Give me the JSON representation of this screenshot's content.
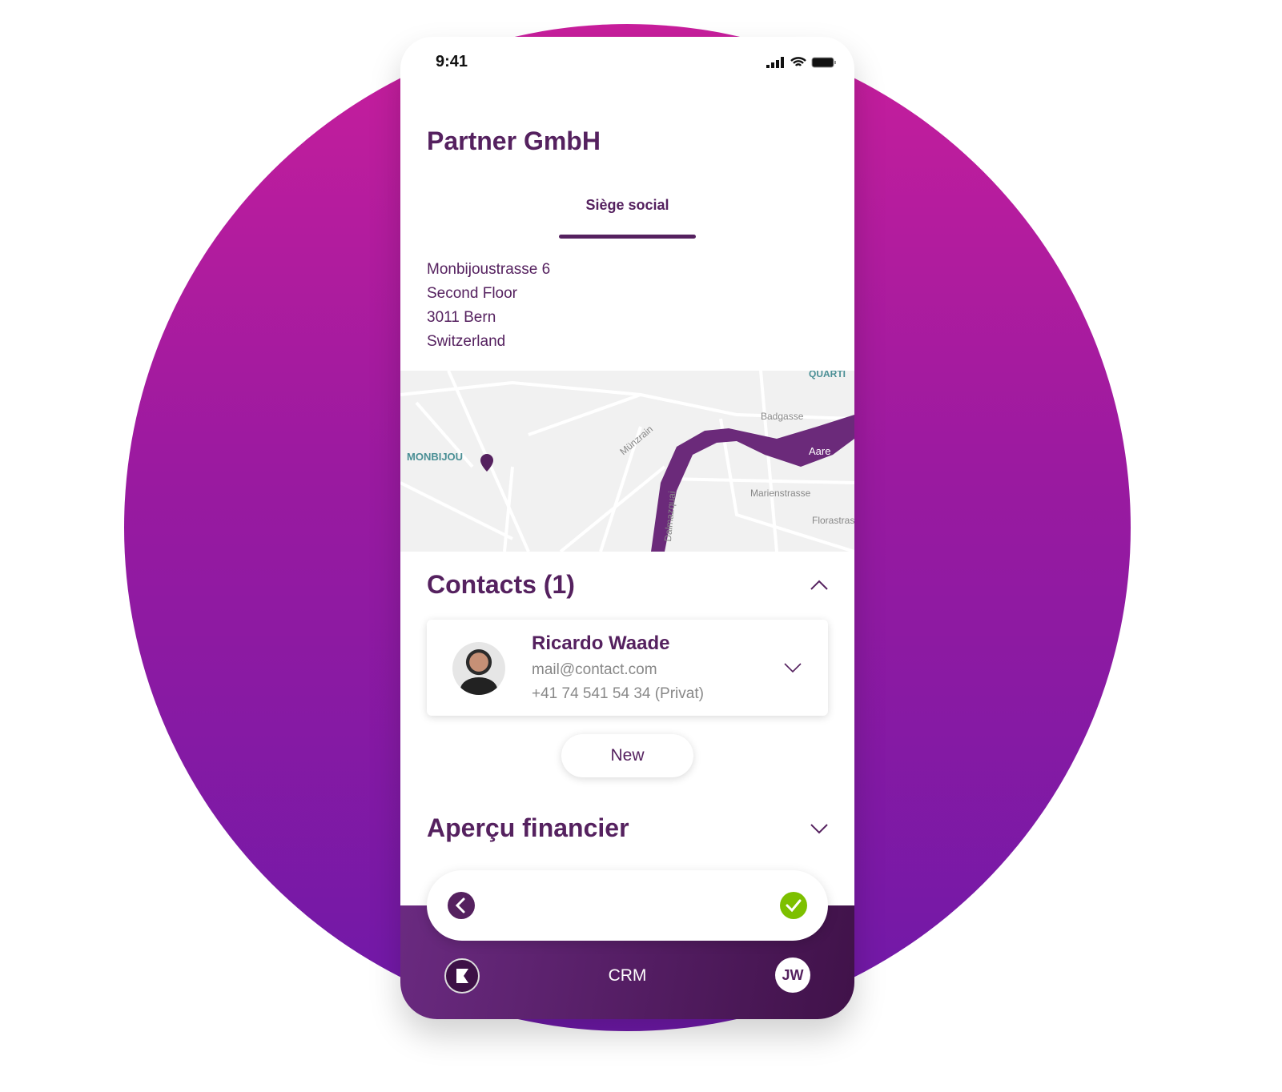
{
  "status_bar": {
    "time": "9:41"
  },
  "header": {
    "title": "Partner GmbH"
  },
  "tabs": [
    {
      "label": "Siège social",
      "active": true
    }
  ],
  "address": {
    "lines": [
      "Monbijoustrasse 6",
      "Second Floor",
      "3011 Bern",
      "Switzerland"
    ]
  },
  "map": {
    "labels": {
      "district": "MONBIJOU",
      "district2": "QUARTI",
      "river": "Aare",
      "street1": "Badgasse",
      "street2": "Marienstrasse",
      "street3": "Florastrasse",
      "street4": "Münzrain",
      "street5": "Dalmazquai"
    }
  },
  "contacts": {
    "title": "Contacts (1)",
    "items": [
      {
        "name": "Ricardo Waade",
        "email": "mail@contact.com",
        "phone": "+41 74 541 54 34 (Privat)"
      }
    ],
    "new_label": "New"
  },
  "finance": {
    "title": "Aperçu financier"
  },
  "bottom_bar": {
    "app_label": "CRM",
    "user_initials": "JW"
  },
  "colors": {
    "brand": "#55215f",
    "confirm": "#7dc000",
    "background_gradient": [
      "#c81e9c",
      "#6e19a8"
    ]
  }
}
